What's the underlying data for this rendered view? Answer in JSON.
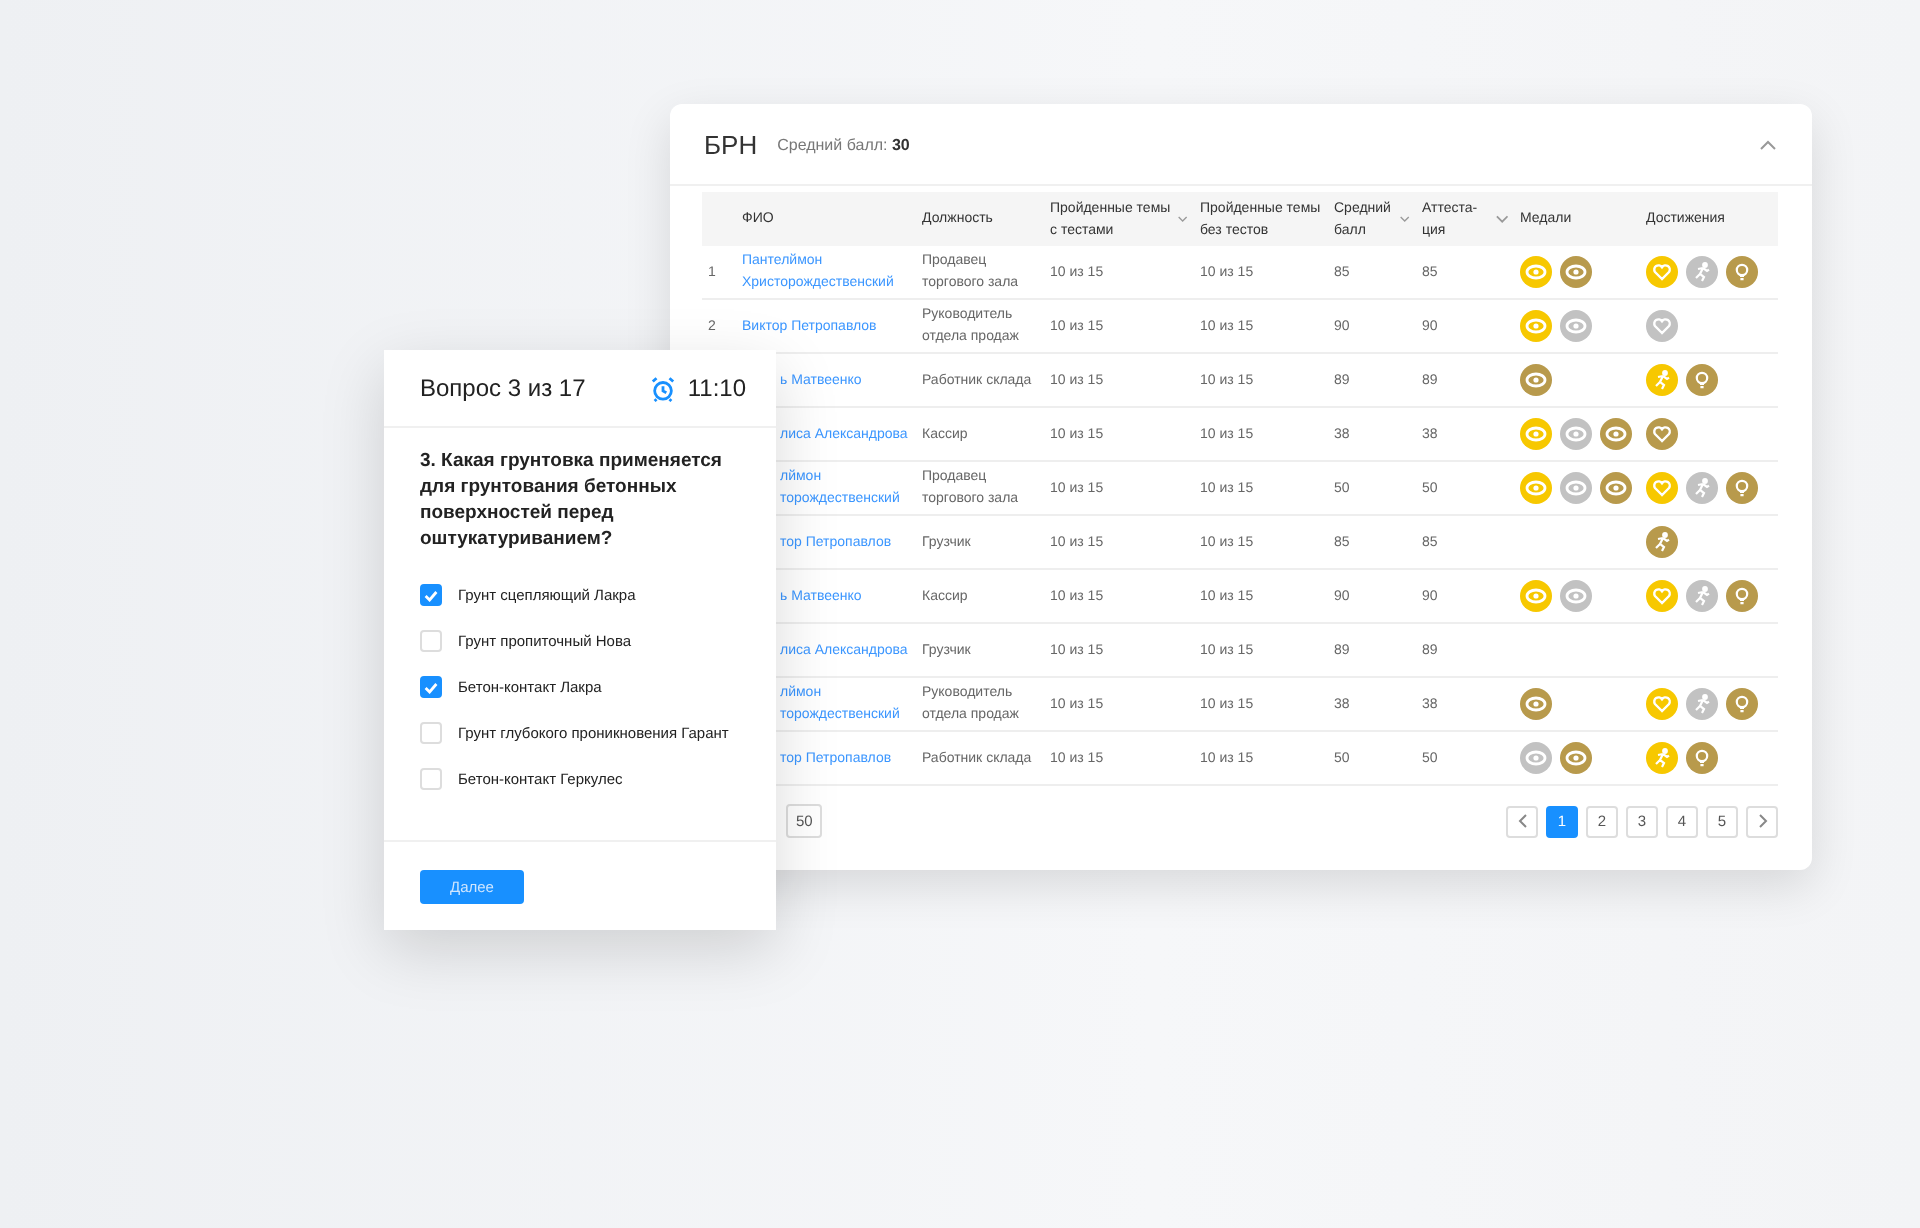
{
  "panel": {
    "title": "БРН",
    "average_label": "Средний балл:",
    "average_value": "30"
  },
  "table": {
    "columns": [
      {
        "label": "ФИО",
        "sortable": false
      },
      {
        "label": "Должность",
        "sortable": false
      },
      {
        "label": "Пройденные темы с тестами",
        "sortable": true
      },
      {
        "label": "Пройденные темы без тестов",
        "sortable": false
      },
      {
        "label": "Средний балл",
        "sortable": true
      },
      {
        "label": "Аттеста-ция",
        "sortable": true
      },
      {
        "label": "Медали",
        "sortable": false
      },
      {
        "label": "Достижения",
        "sortable": false
      }
    ],
    "rows": [
      {
        "number": "1",
        "name": "Пантелймон Христорождественский",
        "position": "Продавец торгового зала",
        "with_tests": "10 из 15",
        "without_tests": "10 из 15",
        "average": "85",
        "attestation": "85",
        "medals": [
          {
            "color": "#f7c800"
          },
          {
            "color": "#b89a4c"
          }
        ],
        "achievements": [
          {
            "kind": "heart",
            "color": "#f7c800"
          },
          {
            "kind": "runner",
            "color": "#c2c2c2"
          },
          {
            "kind": "bulb",
            "color": "#b89a4c"
          }
        ]
      },
      {
        "number": "2",
        "name": "Виктор Петропавлов",
        "position": "Руководитель отдела продаж",
        "with_tests": "10 из 15",
        "without_tests": "10 из 15",
        "average": "90",
        "attestation": "90",
        "medals": [
          {
            "color": "#f7c800"
          },
          {
            "color": "#c2c2c2"
          }
        ],
        "achievements": [
          {
            "kind": "heart",
            "color": "#c2c2c2"
          }
        ]
      },
      {
        "name": "ь Матвеенко",
        "position": "Работник склада",
        "with_tests": "10 из 15",
        "without_tests": "10 из 15",
        "average": "89",
        "attestation": "89",
        "medals": [
          {
            "color": "#b89a4c"
          }
        ],
        "achievements": [
          {
            "kind": "runner",
            "color": "#f7c800"
          },
          {
            "kind": "bulb",
            "color": "#b89a4c"
          }
        ]
      },
      {
        "name": "лиса Александрова",
        "position": "Кассир",
        "with_tests": "10 из 15",
        "without_tests": "10 из 15",
        "average": "38",
        "attestation": "38",
        "medals": [
          {
            "color": "#f7c800"
          },
          {
            "color": "#c2c2c2"
          },
          {
            "color": "#b89a4c"
          }
        ],
        "achievements": [
          {
            "kind": "heart",
            "color": "#b89a4c"
          }
        ]
      },
      {
        "name": "лймон торождественский",
        "position": "Продавец торгового зала",
        "with_tests": "10 из 15",
        "without_tests": "10 из 15",
        "average": "50",
        "attestation": "50",
        "medals": [
          {
            "color": "#f7c800"
          },
          {
            "color": "#c2c2c2"
          },
          {
            "color": "#b89a4c"
          }
        ],
        "achievements": [
          {
            "kind": "heart",
            "color": "#f7c800"
          },
          {
            "kind": "runner",
            "color": "#c2c2c2"
          },
          {
            "kind": "bulb",
            "color": "#b89a4c"
          }
        ]
      },
      {
        "name": "тор Петропавлов",
        "position": "Грузчик",
        "with_tests": "10 из 15",
        "without_tests": "10 из 15",
        "average": "85",
        "attestation": "85",
        "achievements": [
          {
            "kind": "runner",
            "color": "#b89a4c"
          }
        ]
      },
      {
        "name": "ь Матвеенко",
        "position": "Кассир",
        "with_tests": "10 из 15",
        "without_tests": "10 из 15",
        "average": "90",
        "attestation": "90",
        "medals": [
          {
            "color": "#f7c800"
          },
          {
            "color": "#c2c2c2"
          }
        ],
        "achievements": [
          {
            "kind": "heart",
            "color": "#f7c800"
          },
          {
            "kind": "runner",
            "color": "#c2c2c2"
          },
          {
            "kind": "bulb",
            "color": "#b89a4c"
          }
        ]
      },
      {
        "name": "лиса Александрова",
        "position": "Грузчик",
        "with_tests": "10 из 15",
        "without_tests": "10 из 15",
        "average": "89",
        "attestation": "89"
      },
      {
        "name": "лймон торождественский",
        "position": "Руководитель отдела продаж",
        "with_tests": "10 из 15",
        "without_tests": "10 из 15",
        "average": "38",
        "attestation": "38",
        "medals": [
          {
            "color": "#b89a4c"
          }
        ],
        "achievements": [
          {
            "kind": "heart",
            "color": "#f7c800"
          },
          {
            "kind": "runner",
            "color": "#c2c2c2"
          },
          {
            "kind": "bulb",
            "color": "#b89a4c"
          }
        ]
      },
      {
        "name": "тор Петропавлов",
        "position": "Работник склада",
        "with_tests": "10 из 15",
        "without_tests": "10 из 15",
        "average": "50",
        "attestation": "50",
        "medals": [
          {
            "color": "#c2c2c2"
          },
          {
            "color": "#b89a4c"
          }
        ],
        "achievements": [
          {
            "kind": "runner",
            "color": "#f7c800"
          },
          {
            "kind": "bulb",
            "color": "#b89a4c"
          }
        ]
      }
    ]
  },
  "pagination": {
    "page_size": "50",
    "pages": [
      {
        "label": "1",
        "selected": true
      },
      {
        "label": "2",
        "selected": false
      },
      {
        "label": "3",
        "selected": false
      },
      {
        "label": "4",
        "selected": false
      },
      {
        "label": "5",
        "selected": false
      }
    ]
  },
  "quiz": {
    "title": "Вопрос 3 из 17",
    "timer": "11:10",
    "question": "3. Какая грунтовка применяется для грунтования бетонных поверхностей перед оштукатуриванием?",
    "options": [
      {
        "label": "Грунт сцепляющий Лакра",
        "checked": true
      },
      {
        "label": "Грунт пропиточный Нова",
        "checked": false
      },
      {
        "label": "Бетон-контакт Лакра",
        "checked": true
      },
      {
        "label": "Грунт глубокого проникновения Гарант",
        "checked": false
      },
      {
        "label": "Бетон-контакт Геркулес",
        "checked": false
      }
    ],
    "next_button": "Далее"
  }
}
